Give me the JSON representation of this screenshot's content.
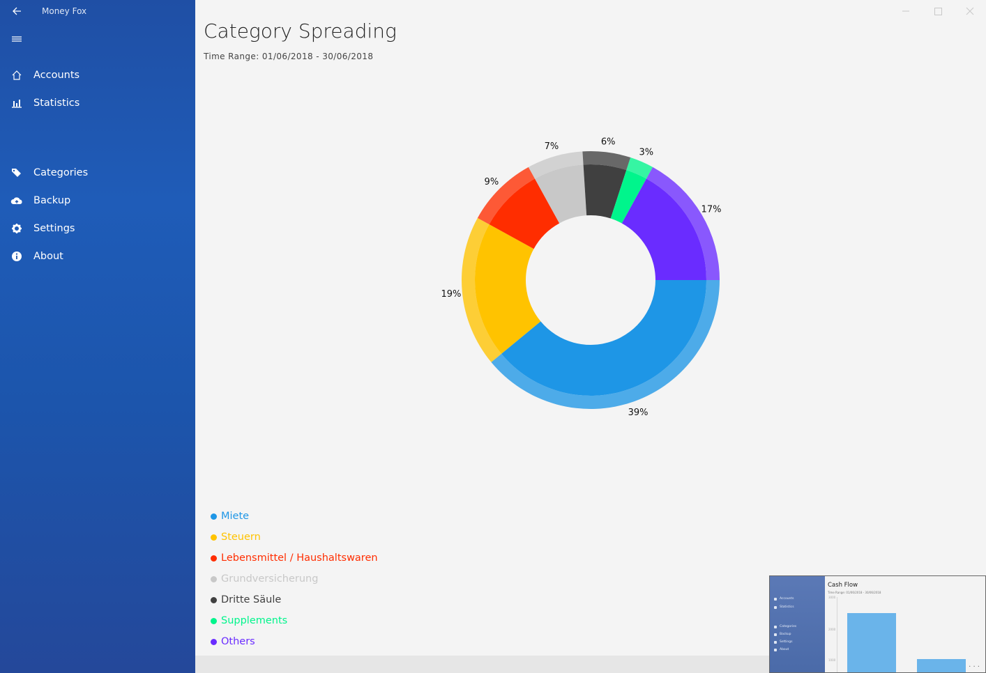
{
  "app": {
    "title": "Money Fox"
  },
  "sidebar": {
    "items": [
      {
        "label": "Accounts",
        "icon": "home-icon"
      },
      {
        "label": "Statistics",
        "icon": "bar-chart-icon"
      },
      {
        "label": "Categories",
        "icon": "tags-icon"
      },
      {
        "label": "Backup",
        "icon": "cloud-upload-icon"
      },
      {
        "label": "Settings",
        "icon": "gear-icon"
      },
      {
        "label": "About",
        "icon": "info-icon"
      }
    ]
  },
  "page": {
    "title": "Category Spreading",
    "time_range": "Time Range: 01/06/2018 - 30/06/2018"
  },
  "chart_data": {
    "type": "pie",
    "title": "",
    "donut": true,
    "slices": [
      {
        "label": "Miete",
        "value": 39,
        "display": "39%",
        "color": "#1e96e6"
      },
      {
        "label": "Steuern",
        "value": 19,
        "display": "19%",
        "color": "#ffc300"
      },
      {
        "label": "Lebensmittel / Haushaltswaren",
        "value": 9,
        "display": "9%",
        "color": "#ff2d00"
      },
      {
        "label": "Grundversicherung",
        "value": 7,
        "display": "7%",
        "color": "#c8c8c8"
      },
      {
        "label": "Dritte Säule",
        "value": 6,
        "display": "6%",
        "color": "#404040"
      },
      {
        "label": "Supplements",
        "value": 3,
        "display": "3%",
        "color": "#00f58c"
      },
      {
        "label": "Others",
        "value": 17,
        "display": "17%",
        "color": "#6a2cff"
      }
    ]
  },
  "preview": {
    "title": "Cash Flow",
    "subtitle": "Time Range: 01/06/2018 - 30/06/2018",
    "nav": [
      "Accounts",
      "Statistics",
      "Categories",
      "Backup",
      "Settings",
      "About"
    ],
    "ticks": [
      "3000",
      "2000",
      "1000"
    ],
    "bars": [
      {
        "value": 2300
      },
      {
        "value": 1000
      }
    ],
    "more": "· · ·"
  }
}
